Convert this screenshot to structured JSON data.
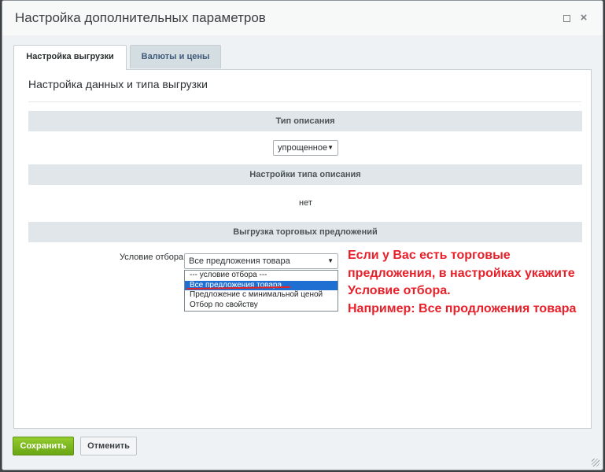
{
  "window": {
    "title": "Настройка дополнительных параметров",
    "maximize_icon": "maximize-icon",
    "close_icon": "close-icon",
    "close_glyph": "×"
  },
  "tabs": [
    {
      "label": "Настройка выгрузки",
      "active": true
    },
    {
      "label": "Валюты и цены",
      "active": false
    }
  ],
  "panel": {
    "heading": "Настройка данных и типа выгрузки",
    "sections": [
      {
        "title": "Тип описания"
      },
      {
        "title": "Настройки типа описания"
      },
      {
        "title": "Выгрузка торговых предложений"
      }
    ],
    "description_type": {
      "selected": "упрощенное"
    },
    "description_settings_value": "нет",
    "offer_filter": {
      "label": "Условие отбора",
      "selected": "Все предложения товара",
      "options": [
        "--- условие отбора ---",
        "Все предложения товара",
        "Предложение с минимальной ценой",
        "Отбор по свойству"
      ],
      "highlighted_index": 1
    }
  },
  "annotation": {
    "lines": [
      "Если у Вас есть торговые",
      "предложения, в настройках укажите",
      "Условие отбора.",
      "Например: Все продложения товара"
    ],
    "color": "#e8202a"
  },
  "footer": {
    "save_label": "Сохранить",
    "cancel_label": "Отменить"
  },
  "colors": {
    "save_button": "#7ab51d",
    "selection": "#1f6ed1",
    "section_bar": "#e0e6e9"
  }
}
